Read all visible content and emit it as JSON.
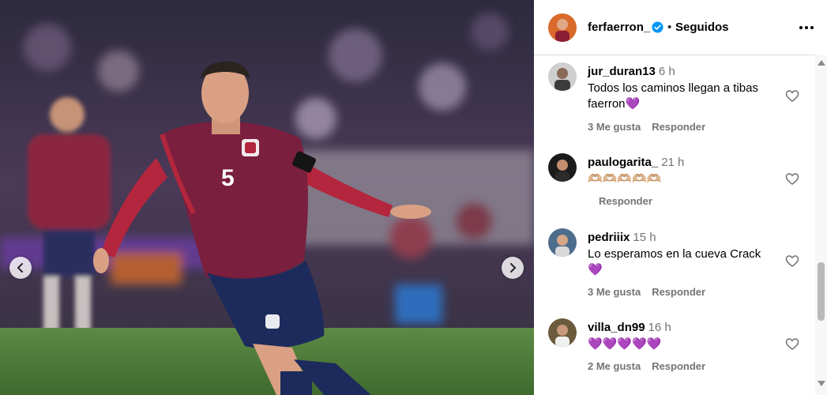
{
  "post": {
    "author": "ferfaerron_",
    "separator": "•",
    "follow_status": "Seguidos",
    "jersey_number": "5"
  },
  "comments": [
    {
      "user": "jur_duran13",
      "time": "6 h",
      "text": "Todos los caminos llegan a tibas faerron💜",
      "likes": "3 Me gusta",
      "reply": "Responder"
    },
    {
      "user": "paulogarita_",
      "time": "21 h",
      "text": "🫶🏼🫶🏼🫶🏼🫶🏼🫶🏼",
      "likes": "",
      "reply": "Responder"
    },
    {
      "user": "pedriiix",
      "time": "15 h",
      "text": "Lo esperamos en la cueva Crack 💜",
      "likes": "3 Me gusta",
      "reply": "Responder"
    },
    {
      "user": "villa_dn99",
      "time": "16 h",
      "text": "💜💜💜💜💜",
      "likes": "2 Me gusta",
      "reply": "Responder"
    }
  ],
  "colors": {
    "verified": "#0095f6",
    "secondary_text": "#737373",
    "jersey": "#7a1f3d",
    "shorts": "#1d2a5c",
    "pitch": "#4f7a3a"
  },
  "icons": {
    "prev": "chevron-left-icon",
    "next": "chevron-right-icon",
    "more": "more-horizontal-icon",
    "like": "heart-outline-icon",
    "verified": "verified-badge-icon"
  }
}
